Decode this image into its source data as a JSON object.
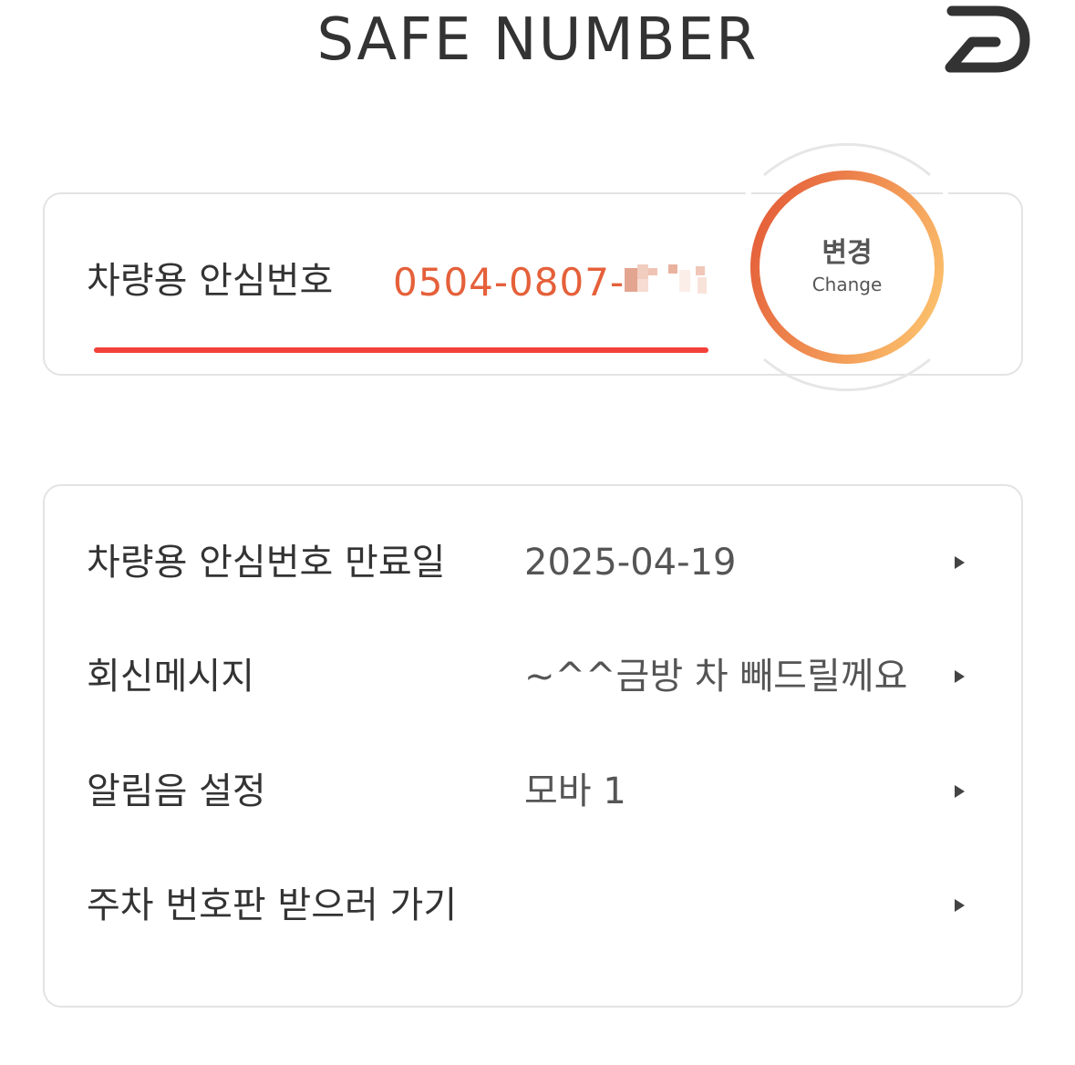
{
  "header": {
    "title": "SAFE NUMBER",
    "logo_icon": "d-logo-icon"
  },
  "safe_number": {
    "label": "차량용 안심번호",
    "value": "0504-0807-",
    "masked_suffix": "pixelated-digits",
    "underline_color": "#f2413a",
    "value_color": "#e5603a"
  },
  "change_button": {
    "label_ko": "변경",
    "label_en": "Change",
    "gradient_start": "#e5603a",
    "gradient_end": "#fbbf6b"
  },
  "settings": [
    {
      "label": "차량용 안심번호 만료일",
      "value": "2025-04-19",
      "icon": "arrow-right-icon"
    },
    {
      "label": "회신메시지",
      "value": "~^^금방 차 빼드릴께요",
      "icon": "arrow-right-icon"
    },
    {
      "label": "알림음 설정",
      "value": "모바 1",
      "icon": "arrow-right-icon"
    },
    {
      "label": "주차 번호판 받으러 가기",
      "value": "",
      "icon": "arrow-right-icon"
    }
  ]
}
